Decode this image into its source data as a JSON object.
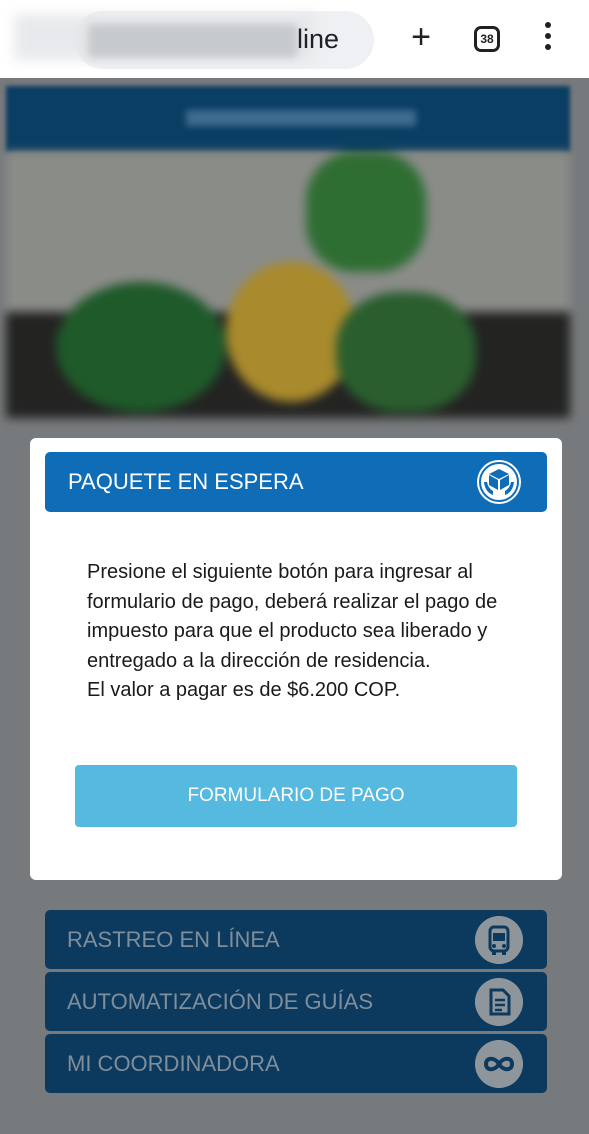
{
  "browser": {
    "url_visible_text": "line",
    "new_tab_icon": "plus-icon",
    "tab_count": "38",
    "menu_icon": "kebab-menu-icon"
  },
  "modal": {
    "title": "PAQUETE EN ESPERA",
    "title_icon": "package-hands-icon",
    "message_line1": "Presione el siguiente botón para ingresar al formulario de pago, deberá realizar el pago de impuesto para que el producto sea liberado y entregado a la dirección de residencia.",
    "message_line2": "El valor a pagar es de $6.200 COP.",
    "button_label": "FORMULARIO DE PAGO"
  },
  "menu": {
    "items": [
      {
        "label": "RASTREO EN LÍNEA",
        "icon": "bus-icon"
      },
      {
        "label": "AUTOMATIZACIÓN DE GUÍAS",
        "icon": "document-icon"
      },
      {
        "label": "MI COORDINADORA",
        "icon": "infinity-icon"
      }
    ]
  },
  "colors": {
    "modal_header": "#0e6db6",
    "pay_button": "#55b9e0",
    "site_header": "#0b3e63",
    "overlay": "#777a7c"
  }
}
